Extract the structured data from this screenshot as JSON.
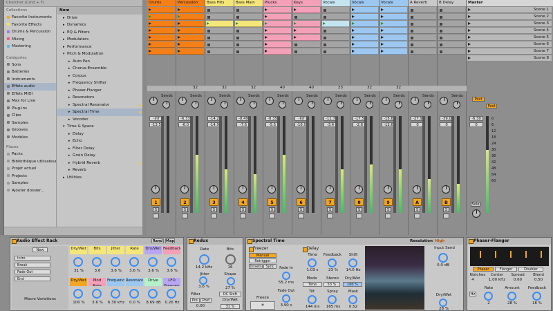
{
  "browser": {
    "search_placeholder": "Chercher (Cmd + F)",
    "collections_title": "Collections",
    "collections": [
      {
        "label": "Favorite Instruments",
        "color": "#f3a623"
      },
      {
        "label": "Favorite Effects",
        "color": "#ffe14d"
      },
      {
        "label": "Drums & Percussion",
        "color": "#9b7bd9"
      },
      {
        "label": "Mixing",
        "color": "#e85a8a"
      },
      {
        "label": "Mastering",
        "color": "#5bb5e8"
      }
    ],
    "categories_title": "Catégories",
    "categories": [
      "Sons",
      "Batteries",
      "Instruments",
      "Effets audio",
      "Effets MIDI",
      "Max for Live",
      "Plug-ins",
      "Clips",
      "Samples",
      "Grooves",
      "Modèles"
    ],
    "places_title": "Places",
    "places": [
      "Packs",
      "Bibliothèque utilisateur",
      "Projet actuel",
      "Projects",
      "Samples",
      "Ajouter dossier..."
    ],
    "name_header": "Nom",
    "files": [
      {
        "label": "Drive",
        "indent": 1,
        "open": false
      },
      {
        "label": "Dynamics",
        "indent": 1,
        "open": false
      },
      {
        "label": "EQ & Filters",
        "indent": 1,
        "open": false
      },
      {
        "label": "Modulators",
        "indent": 1,
        "open": false
      },
      {
        "label": "Performance",
        "indent": 1,
        "open": false
      },
      {
        "label": "Pitch & Modulation",
        "indent": 1,
        "open": true
      },
      {
        "label": "Auto Pan",
        "indent": 2
      },
      {
        "label": "Chorus-Ensemble",
        "indent": 2
      },
      {
        "label": "Corpus",
        "indent": 2
      },
      {
        "label": "Frequency Shifter",
        "indent": 2
      },
      {
        "label": "Phaser-Flanger",
        "indent": 2
      },
      {
        "label": "Resonators",
        "indent": 2
      },
      {
        "label": "Spectral Resonator",
        "indent": 2,
        "flag": true
      },
      {
        "label": "Spectral Time",
        "indent": 2,
        "selected": true,
        "flag": true
      },
      {
        "label": "Vocoder",
        "indent": 2
      },
      {
        "label": "Time & Space",
        "indent": 1,
        "open": true
      },
      {
        "label": "Delay",
        "indent": 2
      },
      {
        "label": "Echo",
        "indent": 2
      },
      {
        "label": "Filter Delay",
        "indent": 2
      },
      {
        "label": "Grain Delay",
        "indent": 2
      },
      {
        "label": "Hybrid Reverb",
        "indent": 2,
        "flag": true
      },
      {
        "label": "Reverb",
        "indent": 2
      },
      {
        "label": "Utilities",
        "indent": 1,
        "open": false
      }
    ]
  },
  "tracks": [
    {
      "name": "Drums",
      "color": "#f57f17",
      "clips": [
        0,
        1,
        2,
        3,
        4,
        5,
        6
      ],
      "playing": 1,
      "vol1": "-Inf",
      "vol2": "-13.5",
      "meter": 0,
      "num": "1",
      "routing": ""
    },
    {
      "name": "Percussion",
      "color": "#f57f17",
      "clips": [
        0,
        1,
        2,
        3,
        4,
        5,
        6
      ],
      "playing": 1,
      "vol1": "-6.33",
      "vol2": "-6.0",
      "meter": 0.6,
      "num": "2",
      "routing": "32"
    },
    {
      "name": "Bass Hits",
      "color": "#f5e67a",
      "clips": [
        2
      ],
      "playing": 2,
      "vol1": "-14.2",
      "vol2": "-14.9",
      "meter": 0.45,
      "num": "3",
      "routing": "32"
    },
    {
      "name": "Bass Main",
      "color": "#f5e67a",
      "clips": [
        2
      ],
      "playing": 2,
      "vol1": "-8.49",
      "vol2": "-7.6",
      "meter": 0.4,
      "num": "4",
      "routing": "32"
    },
    {
      "name": "Plucks",
      "color": "#f3a0b8",
      "clips": [
        0,
        1,
        2,
        3,
        4,
        5,
        6
      ],
      "playing": 2,
      "vol1": "-8.35",
      "vol2": "-5.5",
      "meter": 0.6,
      "num": "5",
      "routing": "40"
    },
    {
      "name": "Keys",
      "color": "#f3a0b8",
      "clips": [
        0,
        2,
        3,
        4
      ],
      "playing": 2,
      "vol1": "-Inf",
      "vol2": "-16.0",
      "meter": 0,
      "num": "6",
      "routing": "40"
    },
    {
      "name": "Vocals",
      "color": "#c4e4ef",
      "clips": [
        2
      ],
      "playing": 2,
      "vol1": "-11.7",
      "vol2": "-3.4",
      "meter": 0.45,
      "num": "7",
      "routing": "23"
    },
    {
      "name": "Vocals",
      "color": "#9cc7f0",
      "clips": [
        0,
        1,
        2,
        3,
        4,
        5,
        6
      ],
      "playing": 2,
      "vol1": "-17.5",
      "vol2": "-2.6",
      "meter": 0.5,
      "num": "8",
      "routing": "32"
    },
    {
      "name": "Vocals",
      "color": "#9cc7f0",
      "clips": [
        0,
        1,
        2,
        3,
        4,
        5,
        6
      ],
      "playing": 2,
      "vol1": "-15.6",
      "vol2": "-12.6",
      "meter": 0.45,
      "num": "9",
      "routing": "32"
    },
    {
      "name": "A Reverb",
      "color": "#c9c9c9",
      "clips": [],
      "playing": -1,
      "vol1": "-27.9",
      "vol2": "0",
      "meter": 0.35,
      "num": "A",
      "routing": ""
    },
    {
      "name": "B Delay",
      "color": "#c9c9c9",
      "clips": [],
      "playing": -1,
      "vol1": "-39.0",
      "vol2": "0",
      "meter": 0.3,
      "num": "B",
      "routing": ""
    }
  ],
  "master": {
    "name": "Master",
    "scenes": [
      "Scene 1",
      "Scene 2",
      "Scene 3",
      "Scene 4",
      "Scene 5",
      "Scene 6",
      "Scene 7",
      "Scene 8"
    ],
    "vol1": "-6.30",
    "vol2": "0",
    "meter": 0.65,
    "post_label": "Post",
    "sends_label": "Sends",
    "solo_label": "Solo",
    "scale": [
      "0",
      "6",
      "12",
      "18",
      "24",
      "30",
      "36",
      "42",
      "48",
      "54",
      "60"
    ]
  },
  "common": {
    "sends": "Sends",
    "s": "S",
    "a": "A",
    "b": "B"
  },
  "devices": {
    "rack": {
      "title": "Audio Effect Rack",
      "new_button": "New",
      "rand": "Rand",
      "map": "Map",
      "chains": [
        "Intro",
        "Break",
        "Fade Out",
        "End"
      ],
      "macro_label": "Macro Variations",
      "macros": [
        {
          "name": "Dry/Wet",
          "value": "31 %",
          "color": "#f5e67a"
        },
        {
          "name": "Bits",
          "value": "3.6",
          "color": "#f5e67a"
        },
        {
          "name": "Jitter",
          "value": "3.6 %",
          "color": "#f5e67a"
        },
        {
          "name": "Rate",
          "value": "3.6 %",
          "color": "#f5e67a"
        },
        {
          "name": "Dry/Wet",
          "value": "3.6 %",
          "color": "#b9a6f2"
        },
        {
          "name": "Feedback",
          "value": "3.6 %",
          "color": "#f3a0b8"
        },
        {
          "name": "Dry/Wet",
          "value": "100 %",
          "color": "#f3a623"
        },
        {
          "name": "Mod Rate",
          "value": "3.6 %",
          "color": "#f3a0b8"
        },
        {
          "name": "Frequency",
          "value": "6.30 kHz",
          "color": "#9cc7f0"
        },
        {
          "name": "Resonance",
          "value": "0.0 %",
          "color": "#9cc7f0"
        },
        {
          "name": "Drive",
          "value": "8.69 dB",
          "color": "#b4f0c8"
        },
        {
          "name": "LFO Frequen",
          "value": "0.26 Hz",
          "color": "#b9a6f2"
        }
      ]
    },
    "redux": {
      "title": "Redux",
      "rate": "Rate",
      "rate_value": "14.2 kHz",
      "jitter": "Jitter",
      "jitter_value": "3.6 %",
      "filter": "Filter",
      "pre": "Pre",
      "post": "Post",
      "filter_value": "0.00",
      "bits": "Bits",
      "bits_value": "16",
      "shape": "Shape",
      "shape_value": "27 %",
      "dc_shift": "DC Shift",
      "drywet": "Dry/Wet",
      "drywet_value": "31 %"
    },
    "spectral": {
      "title": "Spectral Time",
      "freezer": "Freezer",
      "manual": "Manual",
      "retrigger": "Retrigger",
      "onsets": "Onsets",
      "sync": "Sync",
      "fade_in": "Fade In",
      "fade_in_value": "55.2 ms",
      "fade_out": "Fade Out",
      "fade_out_value": "3.90 s",
      "freeze": "Freeze",
      "freeze_symbol": "*",
      "delay": "Delay",
      "time": "Time",
      "time_value": "1.03 s",
      "feedback": "Feedback",
      "feedback_value": "23 %",
      "shift": "Shift",
      "shift_value": "14.0 Hz",
      "mode": "Mode",
      "mode_value": "Time",
      "stereo": "Stereo",
      "stereo_value": "53 %",
      "drywet": "Dry/Wet",
      "drywet_value": "100 %",
      "tilt": "Tilt",
      "tilt_value": "144 ms",
      "spray": "Spray",
      "spray_value": "165 ms",
      "mask": "Mask",
      "mask_value": "0.52",
      "resolution": "Resolution",
      "resolution_value": "High",
      "input_send": "Input Send",
      "input_send_value": "0.0 dB",
      "dw2": "Dry/Wet",
      "dw2_value": "28 %"
    },
    "phaser": {
      "title": "Phaser-Flanger",
      "tabs": [
        "Phaser",
        "Flanger",
        "Doubler"
      ],
      "notches": "Notches",
      "notches_value": "4",
      "center": "Center",
      "center_value": "1.00 kHz",
      "spread": "Spread",
      "spread_value": "0.60",
      "blend": "Blend",
      "blend_value": "0.50",
      "rate": "Rate",
      "rate_value": "2",
      "amount": "Amount",
      "amount_value": "28 %",
      "feedback": "Feedback",
      "feedback_value": "16 %",
      "hz": "Hz"
    }
  }
}
